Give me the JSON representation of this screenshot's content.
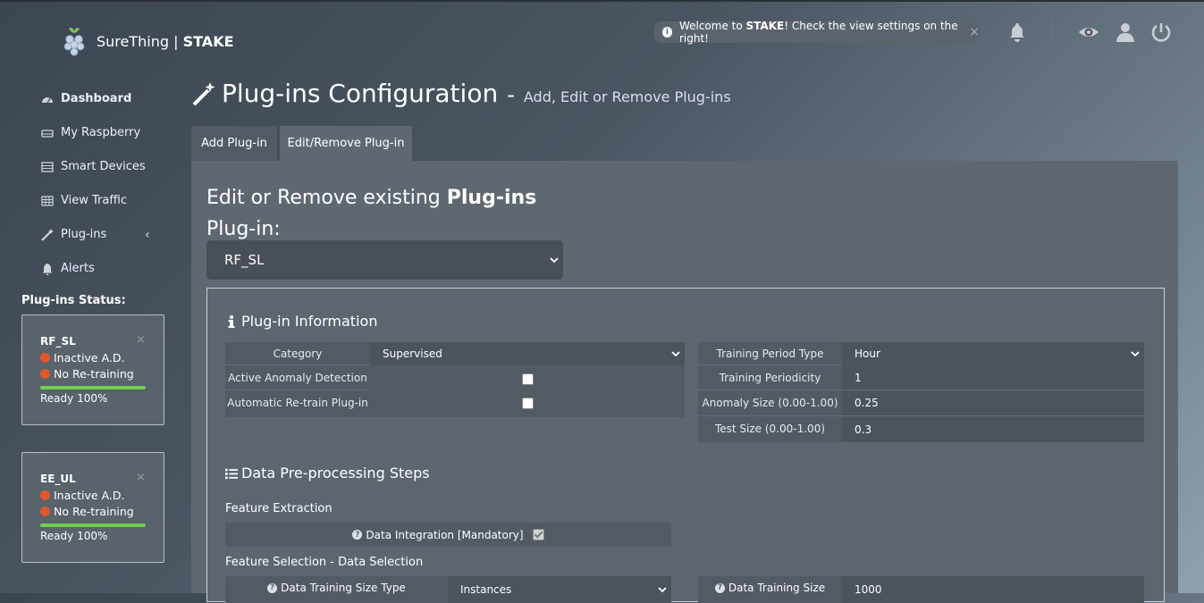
{
  "header": {
    "brand_name": "SureThing",
    "brand_sep": "|",
    "brand_product": "STAKE",
    "toast_pre": "Welcome to ",
    "toast_bold": "STAKE",
    "toast_post": "! Check the view settings on the right!",
    "toast_close": "×",
    "icons": [
      "bell-icon",
      "eye-icon",
      "user-icon",
      "power-icon"
    ]
  },
  "sidebar": {
    "items": [
      {
        "label": "Dashboard",
        "icon": "dashboard-icon"
      },
      {
        "label": "My Raspberry",
        "icon": "hdd-icon"
      },
      {
        "label": "Smart Devices",
        "icon": "list-icon"
      },
      {
        "label": "View Traffic",
        "icon": "table-icon"
      },
      {
        "label": "Plug-ins",
        "icon": "wand-icon",
        "chevron": "‹"
      },
      {
        "label": "Alerts",
        "icon": "bell-icon"
      }
    ],
    "plugins_status_title": "Plug-ins Status:",
    "plugins": [
      {
        "name": "RF_SL",
        "ad": "Inactive A.D.",
        "retrain": "No Re-training",
        "ready": "Ready 100%",
        "progress": 1.0,
        "close": "×"
      },
      {
        "name": "EE_UL",
        "ad": "Inactive A.D.",
        "retrain": "No Re-training",
        "ready": "Ready 100%",
        "progress": 1.0,
        "close": "×"
      }
    ]
  },
  "main": {
    "title": "Plug-ins Configuration",
    "title_dash": "-",
    "subtitle": "Add, Edit or Remove Plug-ins",
    "tabs": [
      {
        "label": "Add Plug-in",
        "active": false
      },
      {
        "label": "Edit/Remove Plug-in",
        "active": true
      }
    ],
    "edit_heading_pre": "Edit or Remove existing ",
    "edit_heading_bold": "Plug-ins",
    "plugin_label": "Plug-in:",
    "plugin_selected": "RF_SL",
    "info_section": {
      "title": "Plug-in Information",
      "category_label": "Category",
      "category_value": "Supervised",
      "active_ad_label": "Active Anomaly Detection",
      "active_ad_checked": false,
      "auto_retrain_label": "Automatic Re-train Plug-in",
      "auto_retrain_checked": false,
      "training_period_type_label": "Training Period Type",
      "training_period_type_value": "Hour",
      "training_periodicity_label": "Training Periodicity",
      "training_periodicity_value": "1",
      "anomaly_size_label": "Anomaly Size (0.00-1.00)",
      "anomaly_size_value": "0.25",
      "test_size_label": "Test Size (0.00-1.00)",
      "test_size_value": "0.3"
    },
    "preproc_section": {
      "title": "Data Pre-processing Steps",
      "feature_extraction_label": "Feature Extraction",
      "data_integration_label": "Data Integration [Mandatory]",
      "data_integration_checked": true,
      "feature_selection_label": "Feature Selection - Data Selection",
      "training_size_type_label": "Data Training Size Type",
      "training_size_type_value": "Instances",
      "training_size_label": "Data Training Size",
      "training_size_value": "1000"
    }
  },
  "colors": {
    "status_inactive": "#e2582a",
    "progress": "#6fcf4f"
  }
}
